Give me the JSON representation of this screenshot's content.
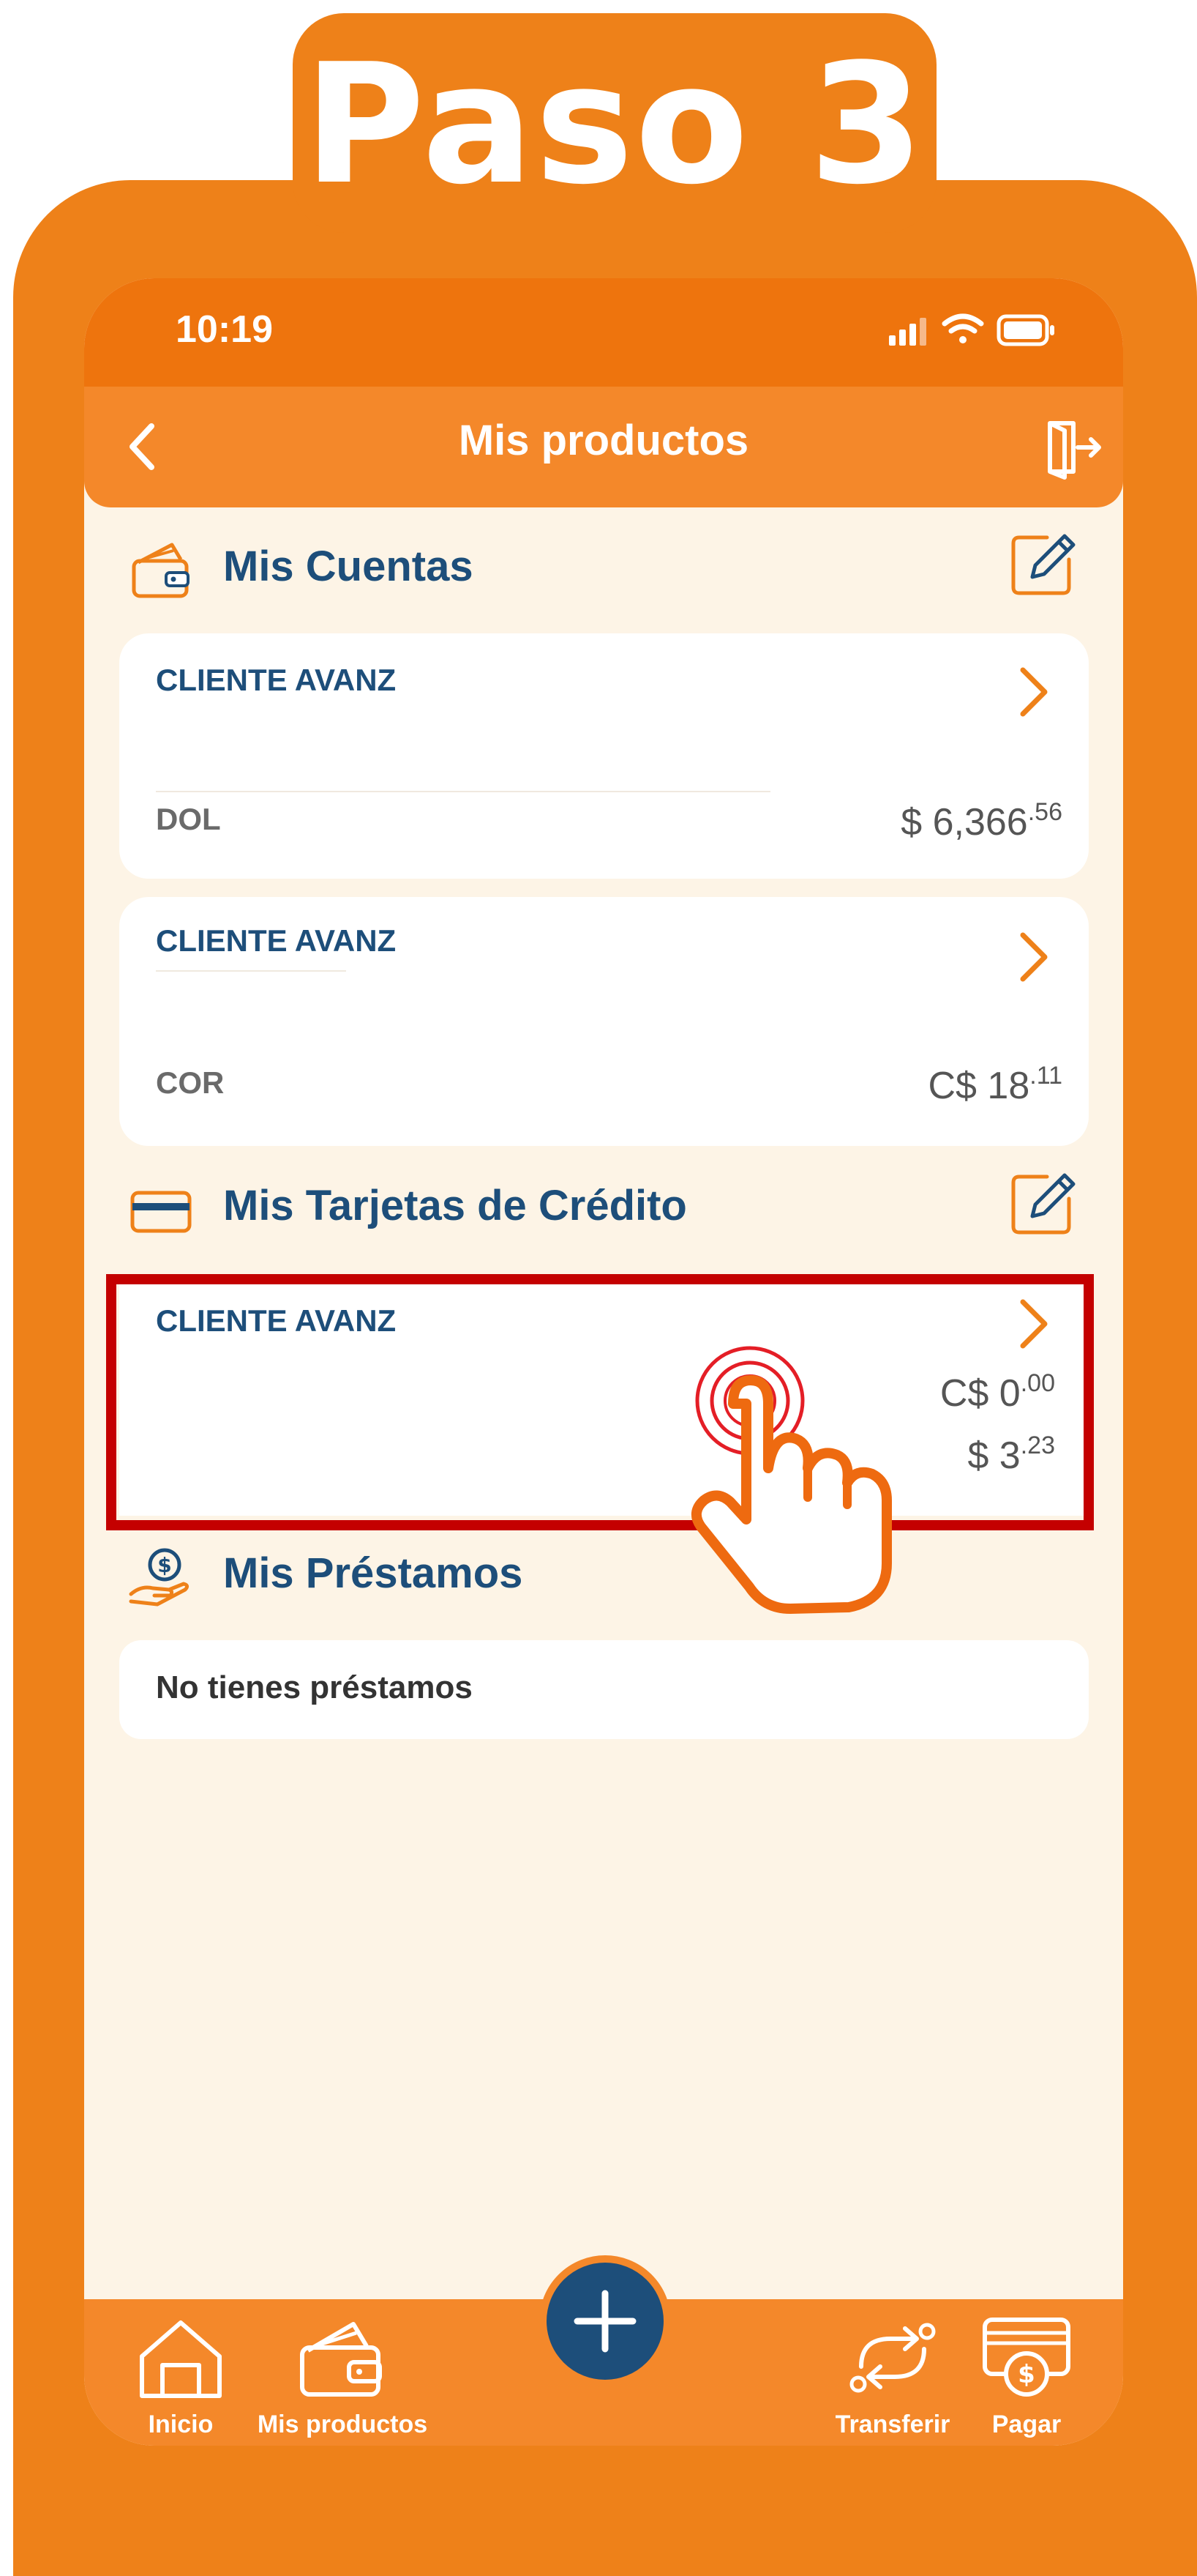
{
  "step": {
    "title": "Paso 3"
  },
  "status_bar": {
    "time": "10:19"
  },
  "nav": {
    "title": "Mis productos"
  },
  "cuentas": {
    "title": "Mis Cuentas",
    "items": [
      {
        "name": "CLIENTE AVANZ",
        "currency": "DOL",
        "amount_main": "$ 6,366",
        "amount_cents": ".56"
      },
      {
        "name": "CLIENTE AVANZ",
        "currency": "COR",
        "amount_main": "C$ 18",
        "amount_cents": ".11"
      }
    ]
  },
  "tarjetas": {
    "title": "Mis Tarjetas de Crédito",
    "items": [
      {
        "name": "CLIENTE AVANZ",
        "amount_1_main": "C$ 0",
        "amount_1_cents": ".00",
        "amount_2_main": "$ 3",
        "amount_2_cents": ".23"
      }
    ]
  },
  "prestamos": {
    "title": "Mis Préstamos",
    "empty": "No tienes préstamos"
  },
  "tabs": [
    {
      "label": "Inicio",
      "icon": "home-icon"
    },
    {
      "label": "Mis productos",
      "icon": "wallet-icon"
    },
    {
      "label": "Transferir",
      "icon": "transfer-icon"
    },
    {
      "label": "Pagar",
      "icon": "pay-icon"
    }
  ],
  "colors": {
    "brand_orange": "#ee8119",
    "header_orange": "#f4882a",
    "navy": "#1d4e7a",
    "highlight_red": "#c40000",
    "background": "#fdf4e6"
  }
}
